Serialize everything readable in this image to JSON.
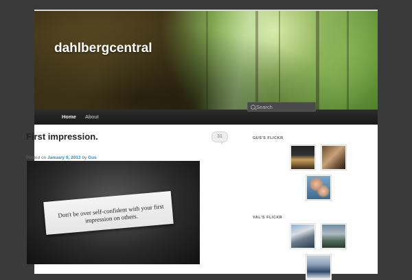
{
  "site": {
    "title": "dahlbergcentral"
  },
  "nav": {
    "items": [
      {
        "label": "Home"
      },
      {
        "label": "About"
      }
    ]
  },
  "search": {
    "placeholder": "Search"
  },
  "post": {
    "title": "First impression.",
    "comment_count": "31",
    "meta": {
      "prefix": "Posted on",
      "date": "January 9, 2013",
      "by": "by",
      "author": "Gus"
    },
    "image_text": "Don't be over self-confident with your first impression on others."
  },
  "sidebar": {
    "widgets": [
      {
        "title": "Gus's Flickr",
        "thumb_count": 3
      },
      {
        "title": "Val's Flickr",
        "thumb_count": 3
      }
    ]
  }
}
